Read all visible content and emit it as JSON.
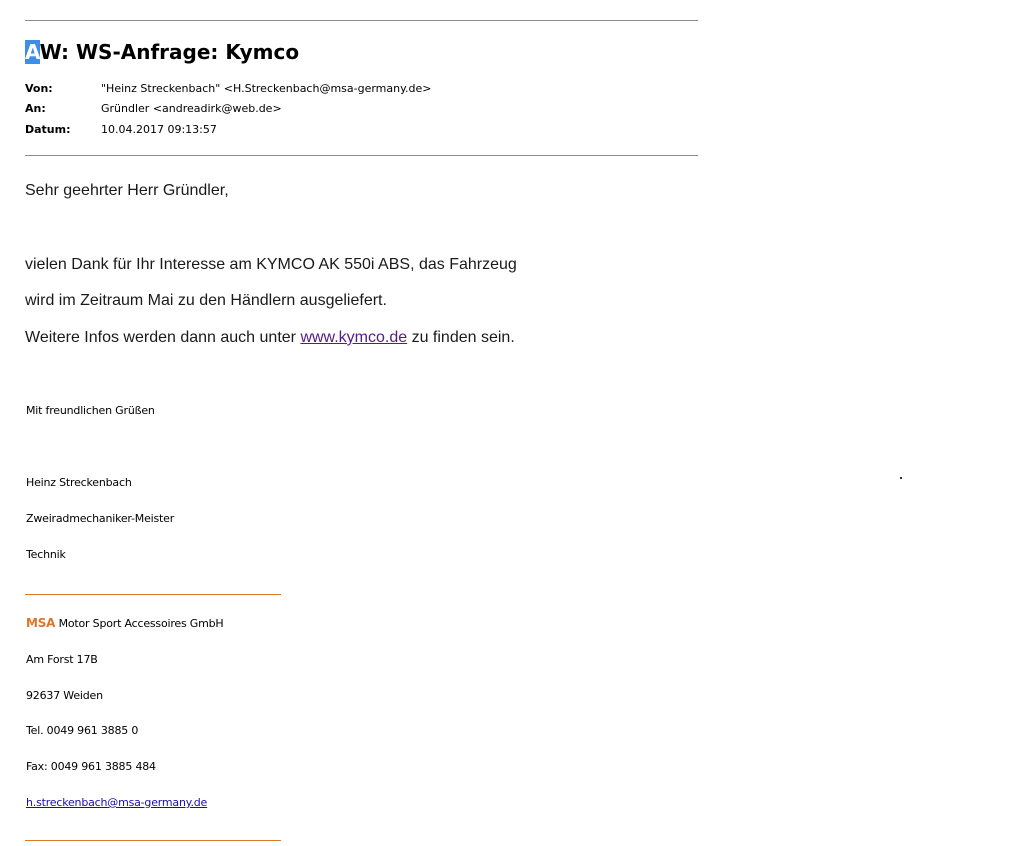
{
  "email": {
    "subject_highlight": "A",
    "subject_rest": "W: WS-Anfrage: Kymco",
    "headers": {
      "from_label": "Von:",
      "from_value": "\"Heinz Streckenbach\" <H.Streckenbach@msa-germany.de>",
      "to_label": "An:",
      "to_value": "Gründler <andreadirk@web.de>",
      "date_label": "Datum:",
      "date_value": "10.04.2017 09:13:57"
    },
    "body": {
      "greeting": "Sehr geehrter Herr Gründler,",
      "line1": "vielen Dank für Ihr Interesse am KYMCO AK 550i ABS, das Fahrzeug",
      "line2": "wird im Zeitraum Mai zu den Händlern ausgeliefert.",
      "line3_before": "Weitere Infos werden dann auch unter ",
      "line3_link": "www.kymco.de",
      "line3_after": " zu finden sein."
    },
    "signature": {
      "closing": "Mit freundlichen Grüßen",
      "name": "Heinz Streckenbach",
      "title": "Zweiradmechaniker-Meister",
      "department": "Technik",
      "company_brand": "MSA",
      "company_rest": " Motor Sport Accessoires GmbH",
      "street": "Am Forst 17B",
      "city": "92637 Weiden",
      "phone": "Tel. 0049 961 3885 0",
      "fax": "Fax: 0049 961 3885 484",
      "email": "h.streckenbach@msa-germany.de"
    }
  },
  "colors": {
    "highlight": "#3d8ee6",
    "brand_orange": "#e0752a",
    "link_visited": "#551a8b",
    "link": "#1a0dab"
  }
}
